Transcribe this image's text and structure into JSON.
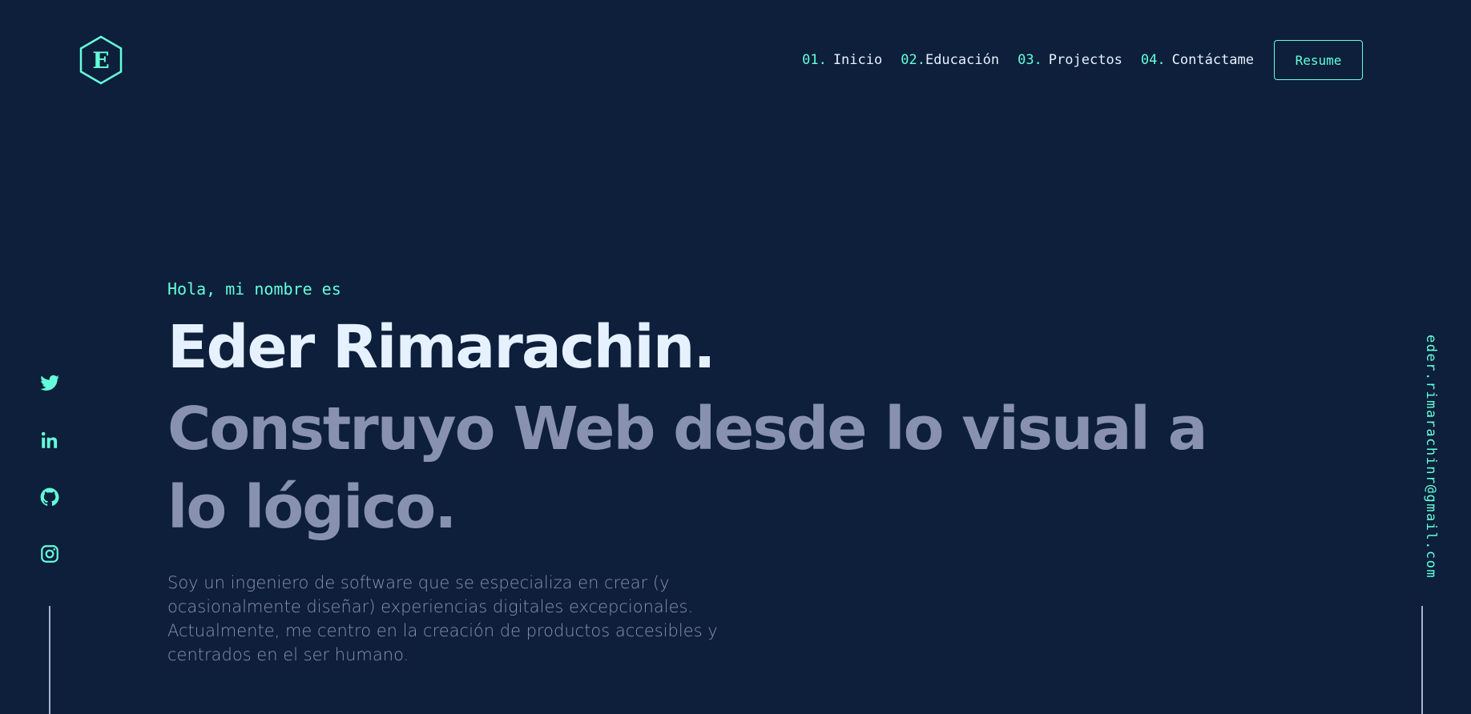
{
  "brand": {
    "logo_letter": "E",
    "logo_icon": "hexagon-logo-icon"
  },
  "nav": {
    "items": [
      {
        "num": "01.",
        "label": "Inicio"
      },
      {
        "num": "02.",
        "label": "Educación"
      },
      {
        "num": "03.",
        "label": "Projectos"
      },
      {
        "num": "04.",
        "label": "Contáctame"
      }
    ],
    "resume_label": "Resume"
  },
  "social": {
    "icons": [
      "twitter-icon",
      "linkedin-icon",
      "github-icon",
      "instagram-icon"
    ]
  },
  "email": "eder.rimarachinr@gmail.com",
  "hero": {
    "intro": "Hola, mi nombre es",
    "name": "Eder Rimarachin.",
    "tagline": "Construyo Web desde lo visual a lo lógico.",
    "bio": "Soy un ingeniero de software que se especializa en crear (y ocasionalmente diseñar) experiencias digitales excepcionales. Actualmente, me centro en la creación de productos accesibles y centrados en el ser humano."
  },
  "colors": {
    "background": "#0d1f3b",
    "accent": "#64ffda",
    "heading": "#e6f1ff",
    "muted": "#8892b0"
  }
}
